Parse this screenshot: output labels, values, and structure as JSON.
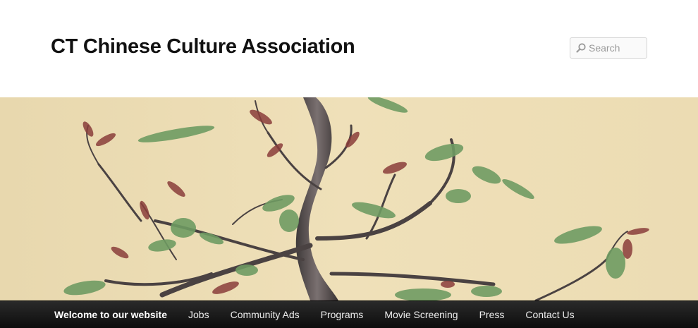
{
  "header": {
    "site_title": "CT Chinese Culture Association"
  },
  "search": {
    "placeholder": "Search",
    "value": "",
    "icon": "search-icon"
  },
  "hero": {
    "image": "bonsai-tree-photo"
  },
  "nav": {
    "items": [
      {
        "label": "Welcome to our website",
        "current": true
      },
      {
        "label": "Jobs"
      },
      {
        "label": "Community Ads"
      },
      {
        "label": "Programs"
      },
      {
        "label": "Movie Screening"
      },
      {
        "label": "Press"
      },
      {
        "label": "Contact Us"
      }
    ]
  },
  "colors": {
    "title_text": "#111111",
    "nav_background": "#1a1a1a",
    "nav_text": "#eeeeee",
    "hero_wall": "#ecdcb4"
  }
}
